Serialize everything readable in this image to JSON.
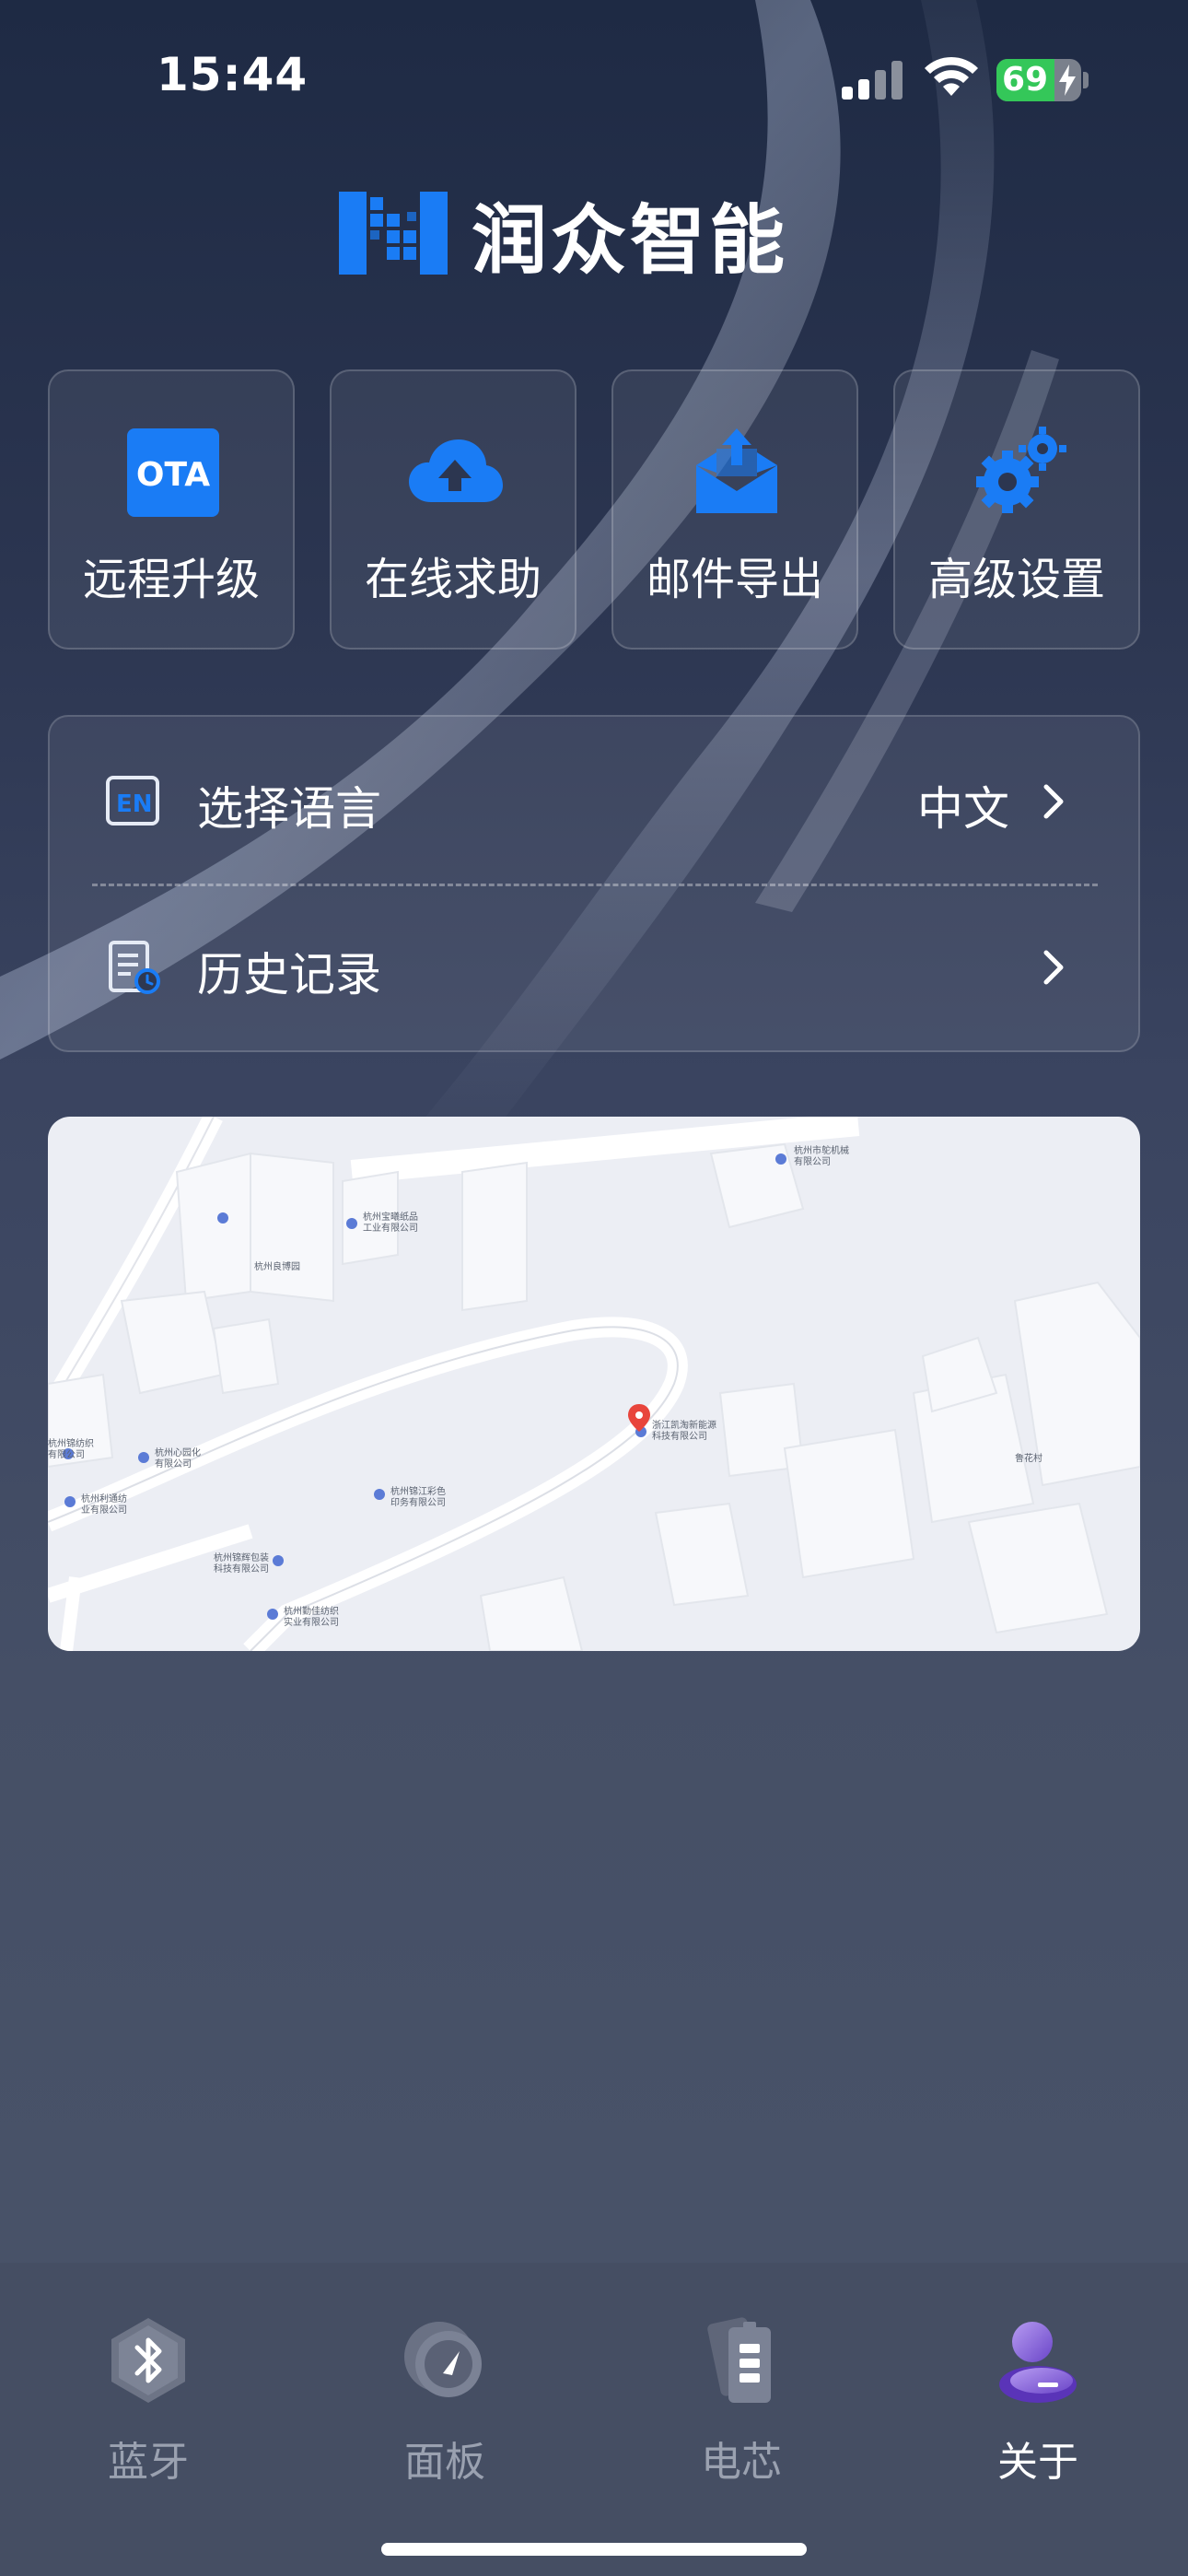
{
  "status_bar": {
    "time": "15:44",
    "battery_percent": "69",
    "battery_level": 0.69,
    "icons": [
      "signal-icon",
      "wifi-icon",
      "battery-icon",
      "charging-bolt-icon"
    ]
  },
  "brand": {
    "name": "润众智能",
    "logo_icon": "brand-n-logo",
    "color": "#1a7cf5"
  },
  "quick_actions": [
    {
      "label": "远程升级",
      "icon": "ota-icon",
      "icon_text": "OTA"
    },
    {
      "label": "在线求助",
      "icon": "cloud-upload-icon"
    },
    {
      "label": "邮件导出",
      "icon": "mail-export-icon"
    },
    {
      "label": "高级设置",
      "icon": "gears-icon"
    }
  ],
  "settings": {
    "language": {
      "label": "选择语言",
      "value": "中文",
      "icon": "language-en-icon",
      "icon_text": "EN"
    },
    "history": {
      "label": "历史记录",
      "icon": "history-record-icon"
    }
  },
  "map": {
    "labels": [
      "杭州市鸵机械\n有限公司",
      "杭州宝曦纸品\n工业有限公司",
      "杭州良博园",
      "浙江凯淘新能源\n科技有限公司",
      "鲁花村",
      "杭州心园化\n有限公司",
      "杭州锦纺织\n有限公司",
      "杭州利通纺\n业有限公司",
      "杭州锦江彩色\n印务有限公司",
      "杭州锦辉包装\n科技有限公司",
      "杭州勤佳纺织\n实业有限公司"
    ]
  },
  "tabs": [
    {
      "label": "蓝牙",
      "icon": "bluetooth-icon",
      "active": false
    },
    {
      "label": "面板",
      "icon": "dashboard-gauge-icon",
      "active": false
    },
    {
      "label": "电芯",
      "icon": "battery-cell-icon",
      "active": false
    },
    {
      "label": "关于",
      "icon": "user-profile-icon",
      "active": true
    }
  ],
  "colors": {
    "accent_blue": "#1a7cf5",
    "active_tab": "#ffffff",
    "inactive_tab": "#9aa1b0",
    "battery_green": "#34c759"
  }
}
